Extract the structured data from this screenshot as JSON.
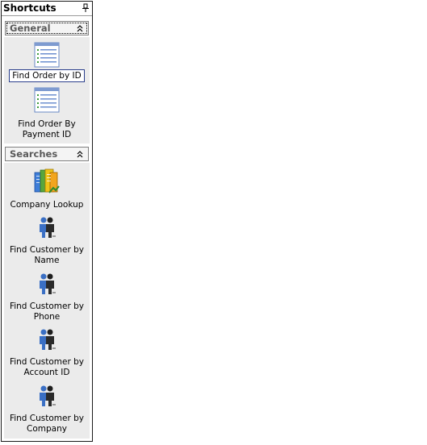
{
  "panel": {
    "title": "Shortcuts",
    "pin_icon": "pin-icon"
  },
  "groups": [
    {
      "title": "General",
      "toggle_icon": "chevron-double-up-icon",
      "items": [
        {
          "label": "Find Order by ID",
          "icon": "document-list-icon",
          "selected": true
        },
        {
          "label": "Find Order By Payment ID",
          "icon": "document-list-icon",
          "selected": false
        }
      ]
    },
    {
      "title": "Searches",
      "toggle_icon": "chevron-double-up-icon",
      "items": [
        {
          "label": "Company Lookup",
          "icon": "company-folders-icon"
        },
        {
          "label": "Find Customer by Name",
          "icon": "people-icon"
        },
        {
          "label": "Find Customer by Phone",
          "icon": "people-icon"
        },
        {
          "label": "Find Customer by Account ID",
          "icon": "people-icon"
        },
        {
          "label": "Find Customer by Company",
          "icon": "people-icon"
        }
      ]
    }
  ]
}
